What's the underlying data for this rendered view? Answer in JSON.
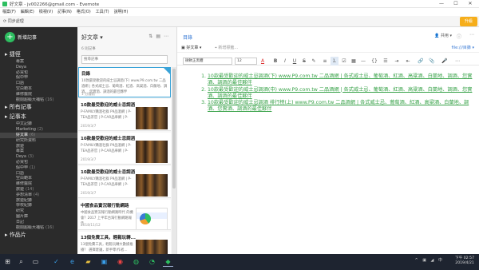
{
  "window": {
    "title": "好文章 - jv002266@gmail.com - Evernote",
    "controls": [
      "—",
      "☐",
      "✕"
    ]
  },
  "menu": [
    "檔案(F)",
    "編輯(E)",
    "檢視(V)",
    "記事(N)",
    "格式(O)",
    "工具(T)",
    "說明(H)"
  ],
  "toolbar": {
    "sync_label": "同步處理",
    "upgrade_label": "升級"
  },
  "sidebar": {
    "new_note_label": "新增記事",
    "items": [
      {
        "label": "捷徑",
        "big": true
      },
      {
        "label": "專案",
        "count": ""
      },
      {
        "label": "Deya",
        "count": ""
      },
      {
        "label": "必買包",
        "count": ""
      },
      {
        "label": "假中甲",
        "count": ""
      },
      {
        "label": "口語",
        "count": ""
      },
      {
        "label": "空白範本",
        "count": ""
      },
      {
        "label": "維修醫院",
        "count": ""
      },
      {
        "label": "觀閱超級大補帖",
        "count": "(16)"
      },
      {
        "label": "所有記事",
        "big": true
      },
      {
        "label": "記事本",
        "big": true
      },
      {
        "label": "中文記錄",
        "count": ""
      },
      {
        "label": "Marketing",
        "count": "(2)"
      },
      {
        "label": "好文章",
        "count": "(6)",
        "selected": true
      },
      {
        "label": "研究所資料",
        "count": ""
      },
      {
        "label": "旅遊",
        "count": ""
      },
      {
        "label": "專案",
        "count": ""
      },
      {
        "label": "Deya",
        "count": "(3)"
      },
      {
        "label": "必買包",
        "count": ""
      },
      {
        "label": "假中甲",
        "count": "(1)"
      },
      {
        "label": "口語",
        "count": ""
      },
      {
        "label": "空白範本",
        "count": ""
      },
      {
        "label": "維修醫院",
        "count": ""
      },
      {
        "label": "旅遊",
        "count": "(14)"
      },
      {
        "label": "夢想清單",
        "count": "(4)"
      },
      {
        "label": "旅遊紀錄",
        "count": ""
      },
      {
        "label": "學校紀錄",
        "count": ""
      },
      {
        "label": "研究",
        "count": ""
      },
      {
        "label": "圖片庫",
        "count": ""
      },
      {
        "label": "日記",
        "count": ""
      },
      {
        "label": "觀閱超級大補帖",
        "count": "(16)"
      },
      {
        "label": "作品片",
        "big": true
      }
    ]
  },
  "notelist": {
    "title": "好文章 ▾",
    "count_label": "6 則記事",
    "search_placeholder": "搜尋記事",
    "cards": [
      {
        "title": "目錄",
        "excerpt": "10款最受歡迎的威士忌調酒(下) www.P9.com.tw 二品酒網 | 各式威士忌、葡萄酒、紅酒、高粱酒、白蘭地、調酒、 您實酒、調酒的最佳夥伴",
        "date": "1 分鐘前",
        "selected": true
      },
      {
        "title": "10款最受歡迎的威士忌調酒",
        "excerpt": "P-FAMILY購酒社群 P9品酒網 | P-TEA品茶官 | P-CAR品車網 | P-",
        "date": "2019/3/7"
      },
      {
        "title": "10款最受歡迎的威士忌調酒",
        "excerpt": "P-FAMILY購酒社群 P9品酒網 | P-TEA品茶官 | P-CAR品車網 | P-",
        "date": "2019/3/7"
      },
      {
        "title": "10款最受歡迎的威士忌調酒",
        "excerpt": "P-FAMILY購酒社群 P9品酒網 | P-TEA品茶官 | P-CAR品車網 | P-",
        "date": "2019/3/7"
      },
      {
        "title": "中國食品實況報行動網路",
        "excerpt": "中國食品實況報行動網路時代 的機會？2017 上半年台灣行動網路報告",
        "date": "2018/11/12"
      },
      {
        "title": "13個免費工具，輕鬆玩轉...",
        "excerpt": "13個免費工具，輕鬆玩轉大數據推播？ 選擇建議，新手零/作者...",
        "date": ""
      }
    ]
  },
  "editor": {
    "note_title": "目錄",
    "share_label": "共用 ▾",
    "notebook_label": "好文章 ▾",
    "tag_placeholder": "新增標籤...",
    "source_url": "file:///目錄",
    "font_family": "微軟正黑體",
    "font_size": "12",
    "list_items": [
      "10款最受歡迎的威士忌調酒(下) www.P9.com.tw 二品酒網 | 各式威士忌、葡萄酒、紅酒、高粱酒、白蘭地、調酒、您實酒、調酒的最佳夥伴",
      "10款最受歡迎的威士忌調酒(中) www.P9.com.tw 二品酒網 | 各式威士忌、葡萄酒、紅酒、高粱酒、白蘭地、調酒、您實酒、調酒的最佳夥伴",
      "10款最受歡迎的威士忌調酒 排行榜(上) www.P9.com.tw 二品酒網 | 各式威士忌、葡萄酒、紅酒、高粱酒、白蘭地、調酒、您實酒、調酒的最佳夥伴"
    ]
  },
  "taskbar": {
    "tray": "^ ▣ ◢ 中",
    "time": "下午 02:57",
    "date": "2019/4/21"
  },
  "colors": {
    "accent_green": "#2dbe60",
    "link_blue": "#3a7bd5",
    "sidebar_bg": "#2b2b2b",
    "upgrade_orange": "#f6ae1b"
  }
}
